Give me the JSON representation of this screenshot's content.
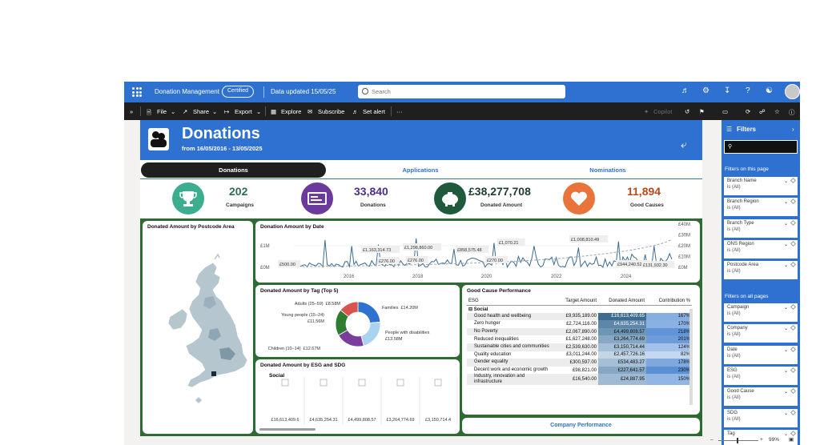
{
  "topbar": {
    "app_name": "Donation Management",
    "certified": "Certified",
    "data_updated": "Data updated 15/05/25",
    "search_placeholder": "Search"
  },
  "toolbar": {
    "file": "File",
    "share": "Share",
    "export": "Export",
    "explore": "Explore",
    "subscribe": "Subscribe",
    "set_alert": "Set alert",
    "more": "···",
    "copilot": "Copilot"
  },
  "header": {
    "title": "Donations",
    "subtitle": "from 16/05/2016 - 13/05/2025"
  },
  "tabs": [
    "Donations",
    "Applications",
    "Nominations"
  ],
  "kpis": [
    {
      "value": "202",
      "label": "Campaigns",
      "color": "#3cae8f",
      "value_color": "#2e6b4f"
    },
    {
      "value": "33,840",
      "label": "Donations",
      "color": "#6a3b9c",
      "value_color": "#4b2f8a"
    },
    {
      "value": "£38,277,708",
      "label": "Donated Amount",
      "color": "#1f5a3d",
      "value_color": "#1f3d2f"
    },
    {
      "value": "11,894",
      "label": "Good Causes",
      "color": "#e8743b",
      "value_color": "#b54a1c"
    }
  ],
  "map_panel": {
    "title": "Donated Amount by Postcode Area"
  },
  "date_chart": {
    "title": "Donation Amount by Date"
  },
  "tag_chart": {
    "title": "Donated Amount by Tag (Top 5)"
  },
  "esg_chart": {
    "title": "Donated Amount by ESG and SDG",
    "group": "Social"
  },
  "good_cause": {
    "title": "Good Cause Performance",
    "columns": [
      "ESG",
      "Target Amount",
      "Donated Amount",
      "Contribution %"
    ],
    "group": "Social",
    "rows": [
      {
        "name": "Good health and wellbeing",
        "target": "£9,935,189.00",
        "donated": "£16,613,409.65",
        "pct": "167%"
      },
      {
        "name": "Zero hunger",
        "target": "£2,724,116.00",
        "donated": "£4,635,254.31",
        "pct": "170%"
      },
      {
        "name": "No Poverty",
        "target": "£2,067,890.00",
        "donated": "£4,499,808.57",
        "pct": "218%"
      },
      {
        "name": "Reduced inequalities",
        "target": "£1,627,248.00",
        "donated": "£3,264,774.69",
        "pct": "201%"
      },
      {
        "name": "Sustainable cities and communities",
        "target": "£2,539,630.00",
        "donated": "£3,150,714.44",
        "pct": "124%"
      },
      {
        "name": "Quality education",
        "target": "£3,011,244.00",
        "donated": "£2,457,726.16",
        "pct": "82%"
      },
      {
        "name": "Gender equality",
        "target": "£300,597.00",
        "donated": "£534,483.27",
        "pct": "178%"
      },
      {
        "name": "Decent work and economic growth",
        "target": "£98,821.00",
        "donated": "£227,641.57",
        "pct": "230%"
      },
      {
        "name": "Industry, innovation and infrastructure",
        "target": "£16,540.00",
        "donated": "£24,887.95",
        "pct": "150%"
      }
    ]
  },
  "company_button": "Company Performance",
  "filters": {
    "title": "Filters",
    "this_page": "Filters on this page",
    "all_pages": "Filters on all pages",
    "page_items": [
      {
        "name": "Branch Name",
        "value": "is (All)"
      },
      {
        "name": "Branch Region",
        "value": "is (All)"
      },
      {
        "name": "Branch Type",
        "value": "is (All)"
      },
      {
        "name": "ONS Region",
        "value": "is (All)"
      },
      {
        "name": "Postcode Area",
        "value": "is (All)"
      }
    ],
    "all_items": [
      {
        "name": "Campaign",
        "value": "is (All)"
      },
      {
        "name": "Company",
        "value": "is (All)"
      },
      {
        "name": "Date",
        "value": "is (All)"
      },
      {
        "name": "ESG",
        "value": "is (All)"
      },
      {
        "name": "Good Cause",
        "value": "is (All)"
      },
      {
        "name": "SDG",
        "value": "is (All)"
      },
      {
        "name": "Tag",
        "value": ""
      }
    ]
  },
  "zoom": "99%",
  "chart_data": [
    {
      "type": "line",
      "title": "Donation Amount by Date",
      "x_ticks": [
        "2016",
        "2018",
        "2020",
        "2022",
        "2024"
      ],
      "y_left_ticks": [
        "£0M",
        "£1M"
      ],
      "y_right_ticks": [
        "£0M",
        "£10M",
        "£20M",
        "£30M",
        "£40M"
      ],
      "data_labels": [
        "£500.00",
        "£1,163,314.73",
        "£276.00",
        "£1,298,860.00",
        "£276.00",
        "£858,575.48",
        "£270.00",
        "£1,070.21",
        "£1,008,810.49",
        "£944,240.52",
        "£131,932.30"
      ]
    },
    {
      "type": "pie",
      "title": "Donated Amount by Tag (Top 5)",
      "slices": [
        {
          "label": "Families",
          "value_text": "£14.20M",
          "value": 14.2,
          "color": "#2f71d0"
        },
        {
          "label": "People with disabilities",
          "value_text": "£13.58M",
          "value": 13.58,
          "color": "#a9d3f0"
        },
        {
          "label": "Children (10–14)",
          "value_text": "£12.67M",
          "value": 12.67,
          "color": "#7b3d9c"
        },
        {
          "label": "Young people (15–24)",
          "value_text": "£11.56M",
          "value": 11.56,
          "color": "#2e7d32"
        },
        {
          "label": "Adults (25–59)",
          "value_text": "£8.58M",
          "value": 8.58,
          "color": "#d9534f"
        }
      ]
    },
    {
      "type": "bar",
      "title": "Donated Amount by ESG and SDG",
      "categories": [
        "Good health and wellbeing",
        "Zero hunger",
        "No Poverty",
        "Reduced inequalities",
        "Sustainable cities and communities"
      ],
      "value_labels": [
        "£16,613,409.6",
        "£4,635,254.31",
        "£4,499,808.57",
        "£3,264,774.69",
        "£3,150,714.4"
      ]
    }
  ]
}
